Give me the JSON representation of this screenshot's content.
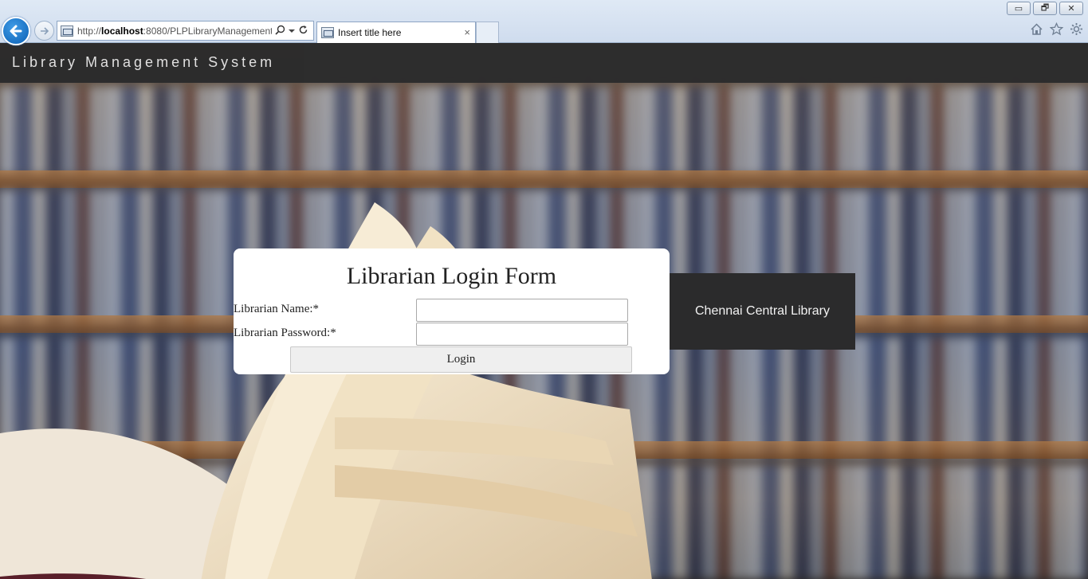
{
  "browser": {
    "url_prefix": "http://",
    "url_host": "localhost",
    "url_rest": ":8080/PLPLibraryManagement",
    "tab_title": "Insert title here",
    "tab_close": "×",
    "window_buttons": [
      "▭",
      "🗗",
      "✕"
    ],
    "icons": [
      "home-icon",
      "favorites-star-icon",
      "settings-gear-icon"
    ]
  },
  "header": {
    "title": "Library Management System"
  },
  "login_form": {
    "title": "Librarian Login Form",
    "name_label": "Librarian Name:*",
    "name_value": "",
    "password_label": "Librarian Password:*",
    "password_value": "",
    "submit_label": "Login"
  },
  "sidebar": {
    "library_name": "Chennai Central Library"
  },
  "colors": {
    "topbar": "#2b2b2c",
    "card": "#ffffff",
    "chrome": "#dfe9f5",
    "back_button": "#0a5fb4"
  }
}
